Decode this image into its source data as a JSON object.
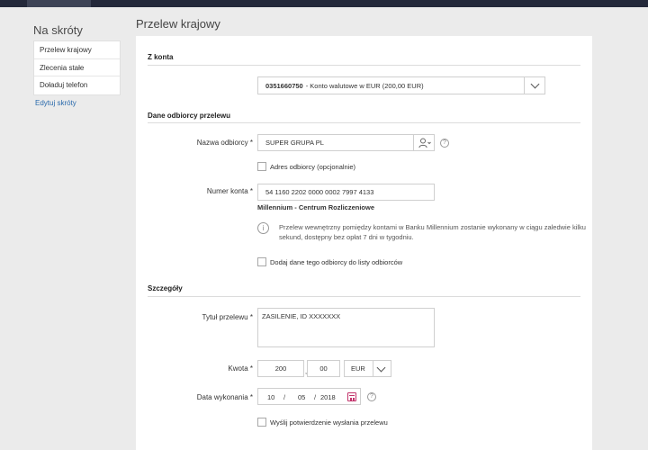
{
  "sidebar": {
    "title": "Na skróty",
    "items": [
      {
        "label": "Przelew krajowy"
      },
      {
        "label": "Zlecenia stałe"
      },
      {
        "label": "Doładuj telefon"
      }
    ],
    "edit_label": "Edytuj skróty"
  },
  "page": {
    "title": "Przelew krajowy"
  },
  "from_account": {
    "section_title": "Z konta",
    "account_number": "0351660750",
    "account_description": "- Konto walutowe w EUR (200,00 EUR)"
  },
  "recipient": {
    "section_title": "Dane odbiorcy przelewu",
    "name_label": "Nazwa odbiorcy",
    "name_value": "SUPER GRUPA PL",
    "address_checkbox_label": "Adres odbiorcy (opcjonalnie)",
    "account_label": "Numer konta",
    "account_value": "54 1160 2202 0000 0002 7997 4133",
    "bank_name": "Millennium - Centrum Rozliczeniowe",
    "info_text": "Przelew wewnętrzny pomiędzy kontami w Banku Millennium zostanie wykonany w ciągu zaledwie kilku sekund, dostępny bez opłat 7 dni w tygodniu.",
    "add_to_list_label": "Dodaj dane tego odbiorcy do listy odbiorców"
  },
  "details": {
    "section_title": "Szczegóły",
    "title_label": "Tytuł przelewu",
    "title_value": "ZASILENIE, ID XXXXXXX",
    "amount_label": "Kwota",
    "amount_whole": "200",
    "amount_fraction": "00",
    "currency": "EUR",
    "date_label": "Data wykonania",
    "date_day": "10",
    "date_month": "05",
    "date_year": "2018",
    "date_separator": "/",
    "confirm_label": "Wyślij potwierdzenie wysłania przelewu"
  },
  "required_marker": "*",
  "help_glyph": "?",
  "info_glyph": "i",
  "colors": {
    "topbar": "#23283a",
    "link": "#2a6aac",
    "calendar_accent": "#c3336b"
  }
}
